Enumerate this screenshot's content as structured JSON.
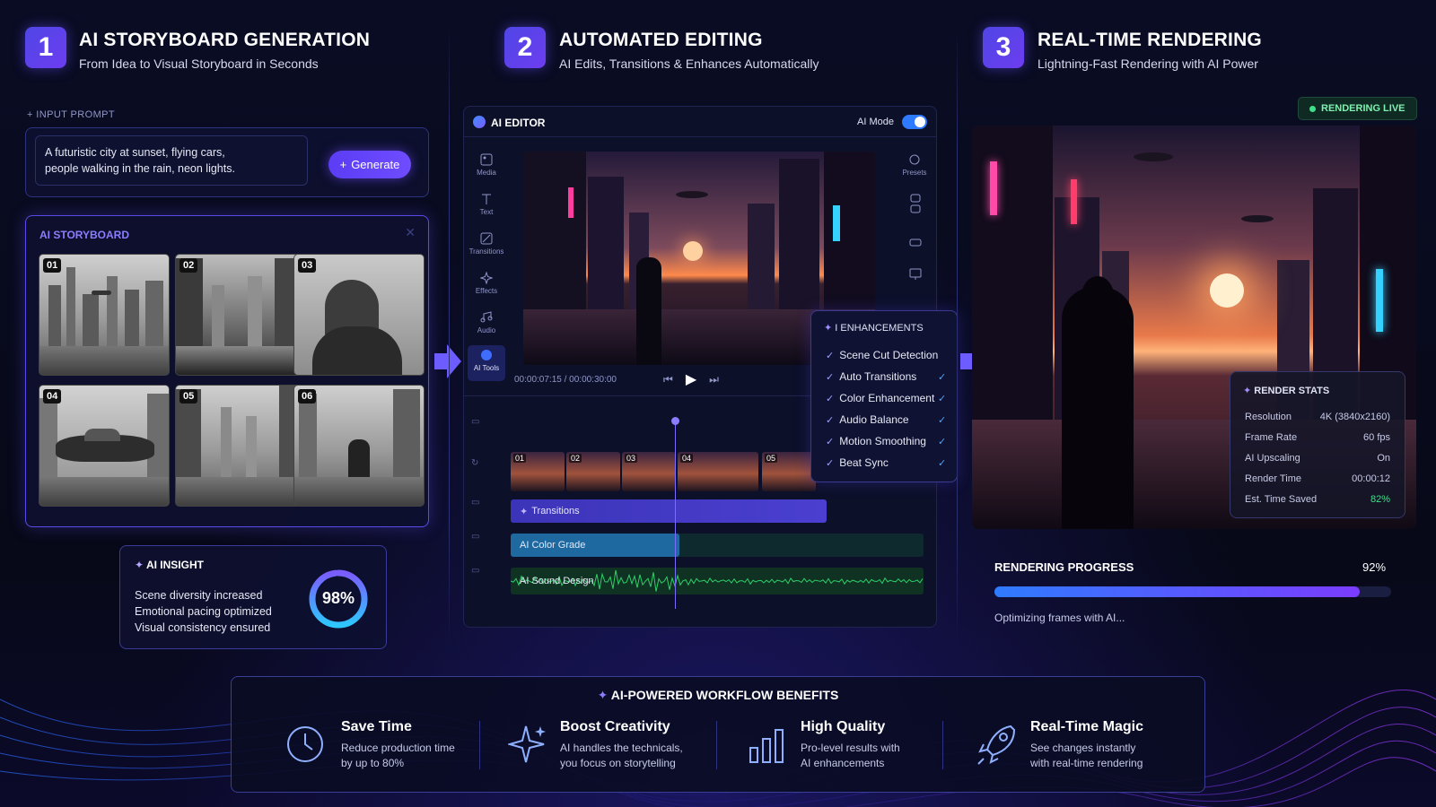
{
  "steps": [
    {
      "number": "1",
      "title": "AI STORYBOARD GENERATION",
      "subtitle": "From Idea to Visual Storyboard in Seconds"
    },
    {
      "number": "2",
      "title": "AUTOMATED EDITING",
      "subtitle": "AI Edits, Transitions & Enhances Automatically"
    },
    {
      "number": "3",
      "title": "REAL-TIME RENDERING",
      "subtitle": "Lightning-Fast Rendering with AI Power"
    }
  ],
  "input_prompt": {
    "label": "INPUT PROMPT",
    "text_line1": "A futuristic city at sunset, flying cars,",
    "text_line2": "people walking in the rain, neon lights.",
    "button_label": "Generate"
  },
  "storyboard": {
    "title": "AI STORYBOARD",
    "frames": [
      "01",
      "02",
      "03",
      "04",
      "05",
      "06"
    ]
  },
  "ai_insight": {
    "title": "AI INSIGHT",
    "lines": [
      "Scene diversity increased",
      "Emotional pacing optimized",
      "Visual consistency ensured"
    ],
    "percent": 98,
    "percent_label": "98%"
  },
  "editor": {
    "title": "AI EDITOR",
    "ai_mode_label": "AI Mode",
    "ai_mode_on": true,
    "tools": [
      "Media",
      "Text",
      "Transitions",
      "Effects",
      "Audio",
      "AI Tools"
    ],
    "right_tools": [
      "Presets"
    ],
    "timecode": "00:00:07:15 / 00:00:30:00",
    "clips": [
      "01",
      "02",
      "03",
      "04",
      "05"
    ],
    "tracks": [
      "Transitions",
      "AI Color Grade",
      "AI Sound Design"
    ]
  },
  "enhancements": {
    "title": "I ENHANCEMENTS",
    "items": [
      "Scene Cut Detection",
      "Auto Transitions",
      "Color Enhancement",
      "Audio Balance",
      "Motion Smoothing",
      "Beat Sync"
    ]
  },
  "render": {
    "live_badge": "RENDERING LIVE",
    "stats_title": "RENDER STATS",
    "stats": [
      {
        "label": "Resolution",
        "value": "4K (3840x2160)"
      },
      {
        "label": "Frame Rate",
        "value": "60 fps"
      },
      {
        "label": "AI Upscaling",
        "value": "On"
      },
      {
        "label": "Render Time",
        "value": "00:00:12"
      },
      {
        "label": "Est. Time Saved",
        "value": "82%"
      }
    ],
    "progress_label": "RENDERING PROGRESS",
    "progress": 92,
    "progress_text": "92%",
    "status": "Optimizing frames with AI..."
  },
  "benefits": {
    "title": "AI-POWERED WORKFLOW BENEFITS",
    "items": [
      {
        "title": "Save Time",
        "line1": "Reduce production time",
        "line2": "by up to 80%"
      },
      {
        "title": "Boost Creativity",
        "line1": "AI handles the technicals,",
        "line2": "you focus on storytelling"
      },
      {
        "title": "High Quality",
        "line1": "Pro-level results with",
        "line2": "AI enhancements"
      },
      {
        "title": "Real-Time Magic",
        "line1": "See changes instantly",
        "line2": "with real-time rendering"
      }
    ]
  },
  "colors": {
    "accent": "#6d5cff",
    "live": "#3ee08a",
    "progress_start": "#2f7bff",
    "progress_end": "#7b3cff"
  }
}
